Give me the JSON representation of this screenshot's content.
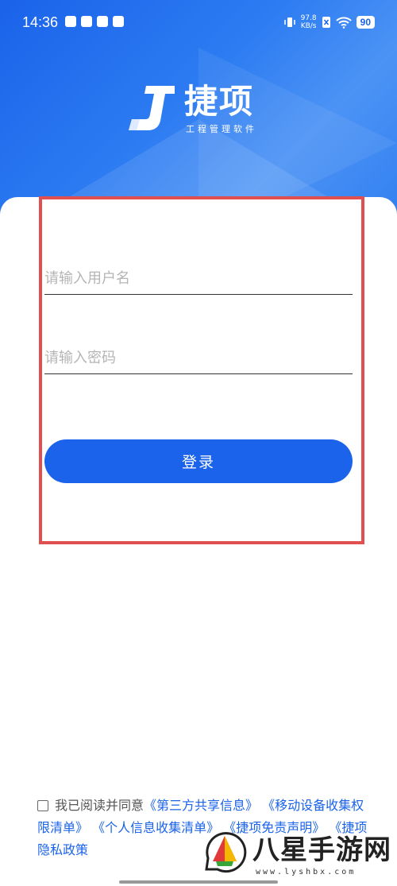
{
  "status_bar": {
    "time": "14:36",
    "app_icons": [
      "tiktok-icon",
      "link-icon",
      "mail-icon",
      "app-icon"
    ],
    "net_speed_value": "97.8",
    "net_speed_unit": "KB/s",
    "battery": "90"
  },
  "brand": {
    "name": "捷项",
    "subtitle": "工程管理软件",
    "accent_color": "#1a63ea"
  },
  "form": {
    "username_placeholder": "请输入用户名",
    "username_value": "",
    "password_placeholder": "请输入密码",
    "password_value": "",
    "login_label": "登录"
  },
  "agreement": {
    "checked": false,
    "prefix": "我已阅读并同意",
    "links": [
      "《第三方共享信息》",
      "《移动设备收集权限清单》",
      "《个人信息收集清单》",
      "《捷项免责声明》",
      "《捷项隐私政策"
    ]
  },
  "watermark": {
    "brand": "八星手游网",
    "url": "www.lyshbx.com"
  }
}
